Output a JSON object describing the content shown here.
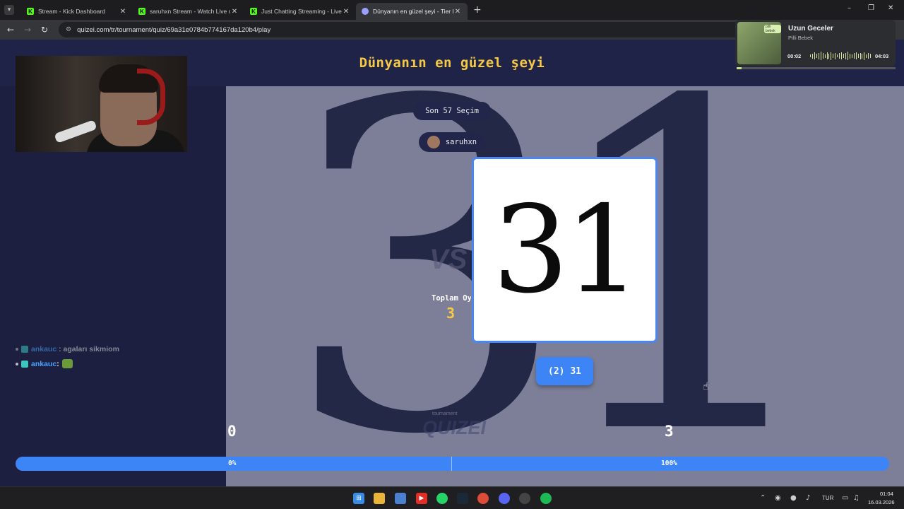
{
  "browser": {
    "tabs": [
      {
        "title": "Stream - Kick Dashboard",
        "active": false,
        "icon": "kick-icon"
      },
      {
        "title": "saruhxn Stream - Watch Live on",
        "active": false,
        "icon": "kick-icon"
      },
      {
        "title": "Just Chatting Streaming - Live",
        "active": false,
        "icon": "kick-icon"
      },
      {
        "title": "Dünyanın en güzel şeyi - Tier Li",
        "active": true,
        "icon": "quizei-icon"
      }
    ],
    "url": "quizei.com/tr/tournament/quiz/69a31e0784b774167da120b4/play"
  },
  "quiz": {
    "title": "Dünyanın en güzel şeyi",
    "recent_badge": "Son 57 Seçim",
    "user_badge": "saruhxn",
    "card_text": "31",
    "choice_button": "(2) 31",
    "vs_text": "VS",
    "total_label": "Toplam Oy",
    "total_value": "3",
    "watermark_small": "tournament",
    "watermark_logo": "QUIZEI",
    "score_left": "0",
    "score_right": "3",
    "percent_left": "0%",
    "percent_right": "100%",
    "progress_right_fraction": 1.0
  },
  "chat": [
    {
      "user": "ankauc",
      "message": "agaları sikmiom"
    },
    {
      "user": "ankauc",
      "message": ":"
    }
  ],
  "music": {
    "title": "Uzun Geceler",
    "artist": "Pilli Bebek",
    "art_tag": "pilli bebek",
    "time_current": "00:02",
    "time_total": "04:03"
  },
  "taskbar": {
    "lang": "TUR",
    "time": "01:04",
    "date": "16.03.2026"
  },
  "colors": {
    "accent": "#3d84f7",
    "title_yellow": "#f6c945",
    "page_bg": "#1c1f3f"
  }
}
